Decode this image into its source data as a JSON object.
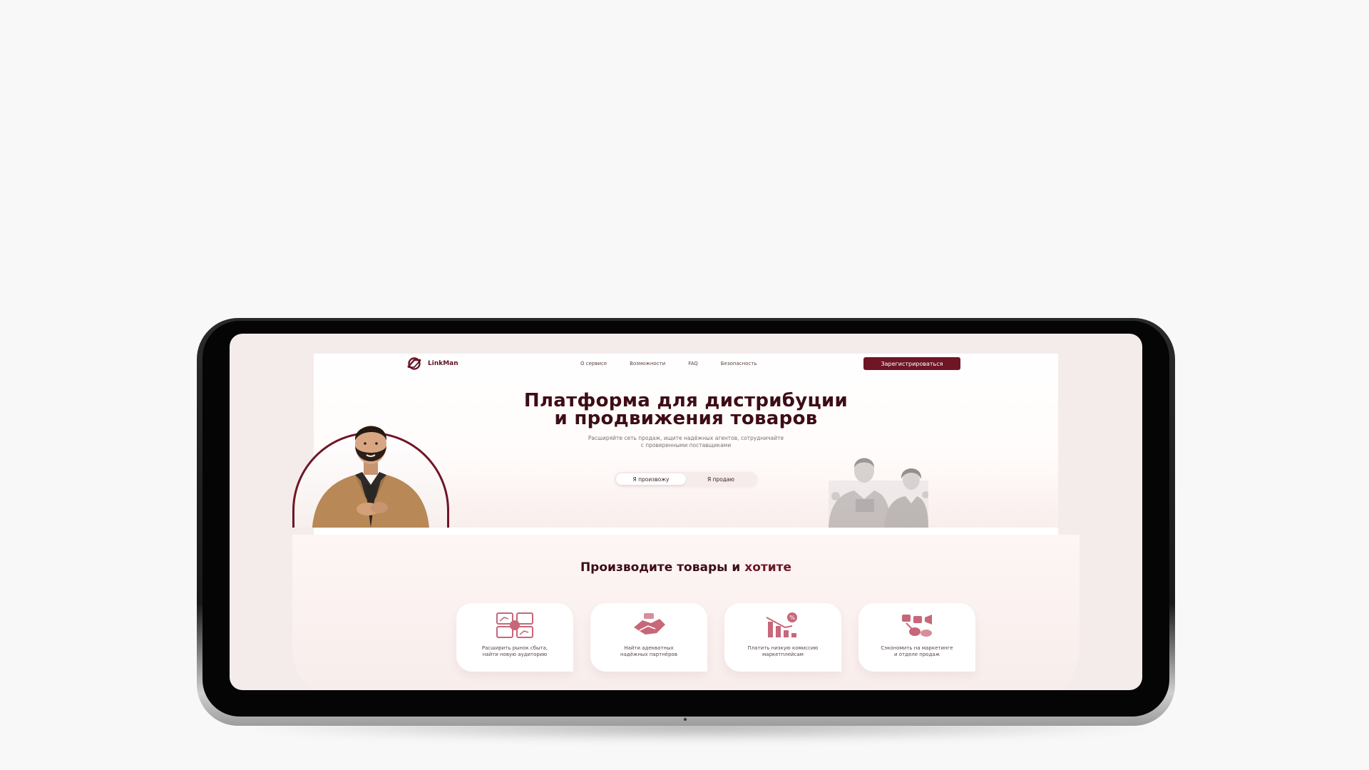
{
  "brand": {
    "name": "LinkMan",
    "accent": "#6e1626"
  },
  "nav": {
    "links": [
      "О сервисе",
      "Возможности",
      "FAQ",
      "Безопасность"
    ],
    "register_label": "Зарегистрироваться"
  },
  "hero": {
    "title_line1": "Платформа для дистрибуции",
    "title_line2": "и продвижения товаров",
    "subtitle_line1": "Расширяйте сеть продаж, ищите надёжных агентов, сотрудничайте",
    "subtitle_line2": "с проверенными поставщиками",
    "roles": [
      "Я произвожу",
      "Я продаю"
    ],
    "active_role": "Я произвожу"
  },
  "features": {
    "title_start": "Производите товары и ",
    "title_accent": "хотите",
    "cards": [
      {
        "icon": "market-expansion-icon",
        "line1": "Расширить рынок сбыта,",
        "line2": "найти новую аудиторию"
      },
      {
        "icon": "handshake-partners-icon",
        "line1": "Найти адекватных",
        "line2": "надёжных партнёров"
      },
      {
        "icon": "low-commission-icon",
        "line1": "Платить низкую комиссию",
        "line2": "маркетплейсам"
      },
      {
        "icon": "marketing-savings-icon",
        "line1": "Сэкономить на маркетинге",
        "line2": "и отделе продаж"
      }
    ]
  }
}
